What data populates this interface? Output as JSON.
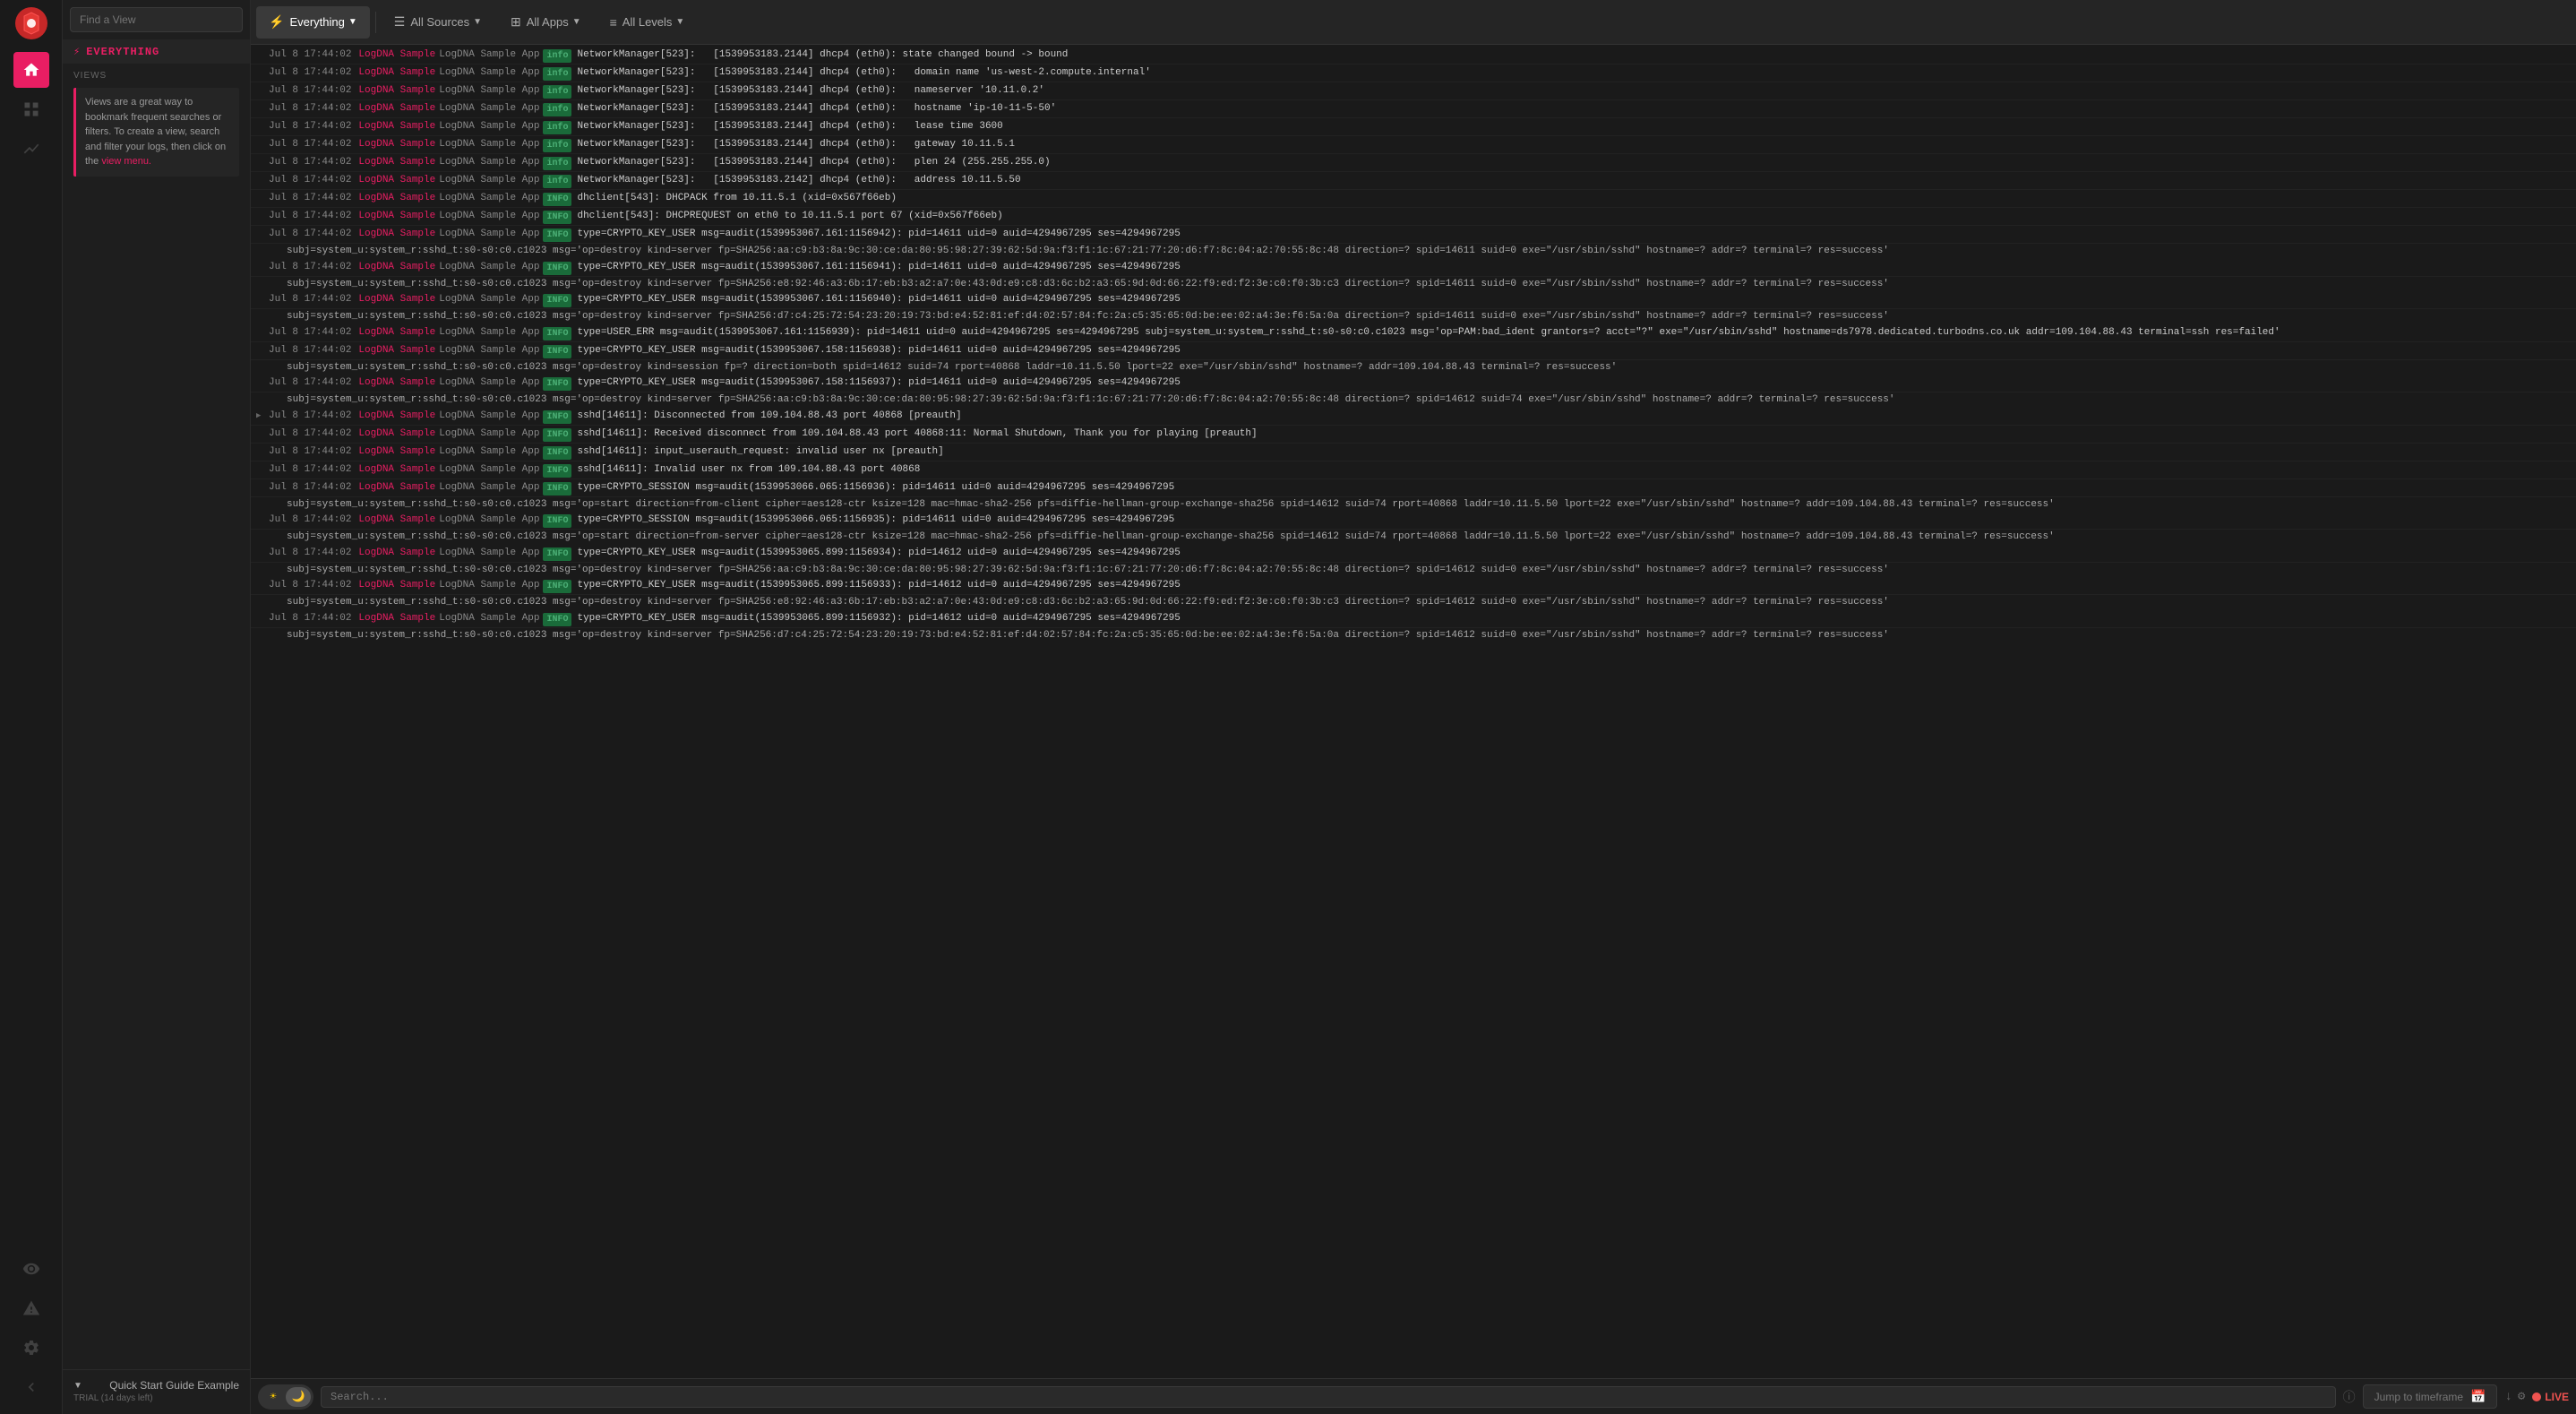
{
  "sidebar": {
    "logo_label": "LogDNA",
    "find_view_placeholder": "Find a View",
    "everything_label": "EVERYTHING",
    "views_label": "VIEWS",
    "views_hint_text": "Views are a great way to bookmark frequent searches or filters. To create a view, search and filter your logs, then click on the ",
    "views_hint_link": "view menu.",
    "quick_start_title": "Quick Start Guide Example",
    "trial_text": "TRIAL (14 days left)"
  },
  "topbar": {
    "everything_label": "Everything",
    "all_sources_label": "All Sources",
    "all_apps_label": "All Apps",
    "all_levels_label": "All Levels"
  },
  "bottombar": {
    "search_placeholder": "Search...",
    "jump_to_timeframe": "Jump to timeframe",
    "live_label": "LIVE"
  },
  "logs": [
    {
      "timestamp": "Jul 8 17:44:02",
      "source": "LogDNA Sample",
      "app": "LogDNA Sample App",
      "level": "info",
      "message": "NetworkManager[523]: <info>  [1539953183.2144] dhcp4 (eth0): state changed bound -> bound"
    },
    {
      "timestamp": "Jul 8 17:44:02",
      "source": "LogDNA Sample",
      "app": "LogDNA Sample App",
      "level": "info",
      "message": "NetworkManager[523]: <info>  [1539953183.2144] dhcp4 (eth0):   domain name 'us-west-2.compute.internal'"
    },
    {
      "timestamp": "Jul 8 17:44:02",
      "source": "LogDNA Sample",
      "app": "LogDNA Sample App",
      "level": "info",
      "message": "NetworkManager[523]: <info>  [1539953183.2144] dhcp4 (eth0):   nameserver '10.11.0.2'"
    },
    {
      "timestamp": "Jul 8 17:44:02",
      "source": "LogDNA Sample",
      "app": "LogDNA Sample App",
      "level": "info",
      "message": "NetworkManager[523]: <info>  [1539953183.2144] dhcp4 (eth0):   hostname 'ip-10-11-5-50'"
    },
    {
      "timestamp": "Jul 8 17:44:02",
      "source": "LogDNA Sample",
      "app": "LogDNA Sample App",
      "level": "info",
      "message": "NetworkManager[523]: <info>  [1539953183.2144] dhcp4 (eth0):   lease time 3600"
    },
    {
      "timestamp": "Jul 8 17:44:02",
      "source": "LogDNA Sample",
      "app": "LogDNA Sample App",
      "level": "info",
      "message": "NetworkManager[523]: <info>  [1539953183.2144] dhcp4 (eth0):   gateway 10.11.5.1"
    },
    {
      "timestamp": "Jul 8 17:44:02",
      "source": "LogDNA Sample",
      "app": "LogDNA Sample App",
      "level": "info",
      "message": "NetworkManager[523]: <info>  [1539953183.2144] dhcp4 (eth0):   plen 24 (255.255.255.0)"
    },
    {
      "timestamp": "Jul 8 17:44:02",
      "source": "LogDNA Sample",
      "app": "LogDNA Sample App",
      "level": "info",
      "message": "NetworkManager[523]: <info>  [1539953183.2142] dhcp4 (eth0):   address 10.11.5.50"
    },
    {
      "timestamp": "Jul 8 17:44:02",
      "source": "LogDNA Sample",
      "app": "LogDNA Sample App",
      "level": "INFO",
      "message": "dhclient[543]: DHCPACK from 10.11.5.1 (xid=0x567f66eb)"
    },
    {
      "timestamp": "Jul 8 17:44:02",
      "source": "LogDNA Sample",
      "app": "LogDNA Sample App",
      "level": "INFO",
      "message": "dhclient[543]: DHCPREQUEST on eth0 to 10.11.5.1 port 67 (xid=0x567f66eb)"
    },
    {
      "timestamp": "Jul 8 17:44:02",
      "source": "LogDNA Sample",
      "app": "LogDNA Sample App",
      "level": "INFO",
      "message": "type=CRYPTO_KEY_USER msg=audit(1539953067.161:1156942): pid=14611 uid=0 auid=4294967295 ses=4294967295",
      "continuation": "subj=system_u:system_r:sshd_t:s0-s0:c0.c1023 msg='op=destroy kind=server fp=SHA256:aa:c9:b3:8a:9c:30:ce:da:80:95:98:27:39:62:5d:9a:f3:f1:1c:67:21:77:20:d6:f7:8c:04:a2:70:55:8c:48 direction=? spid=14611 suid=0  exe=\"/usr/sbin/sshd\" hostname=? addr=? terminal=? res=success'"
    },
    {
      "timestamp": "Jul 8 17:44:02",
      "source": "LogDNA Sample",
      "app": "LogDNA Sample App",
      "level": "INFO",
      "message": "type=CRYPTO_KEY_USER msg=audit(1539953067.161:1156941): pid=14611 uid=0 auid=4294967295 ses=4294967295",
      "continuation": "subj=system_u:system_r:sshd_t:s0-s0:c0.c1023 msg='op=destroy kind=server fp=SHA256:e8:92:46:a3:6b:17:eb:b3:a2:a7:0e:43:0d:e9:c8:d3:6c:b2:a3:65:9d:0d:66:22:f9:ed:f2:3e:c0:f0:3b:c3 direction=? spid=14611 suid=0  exe=\"/usr/sbin/sshd\" hostname=? addr=? terminal=? res=success'"
    },
    {
      "timestamp": "Jul 8 17:44:02",
      "source": "LogDNA Sample",
      "app": "LogDNA Sample App",
      "level": "INFO",
      "message": "type=CRYPTO_KEY_USER msg=audit(1539953067.161:1156940): pid=14611 uid=0 auid=4294967295 ses=4294967295",
      "continuation": "subj=system_u:system_r:sshd_t:s0-s0:c0.c1023 msg='op=destroy kind=server fp=SHA256:d7:c4:25:72:54:23:20:19:73:bd:e4:52:81:ef:d4:02:57:84:fc:2a:c5:35:65:0d:be:ee:02:a4:3e:f6:5a:0a direction=? spid=14611 suid=0  exe=\"/usr/sbin/sshd\" hostname=? addr=? terminal=? res=success'"
    },
    {
      "timestamp": "Jul 8 17:44:02",
      "source": "LogDNA Sample",
      "app": "LogDNA Sample App",
      "level": "INFO",
      "message": "type=USER_ERR msg=audit(1539953067.161:1156939): pid=14611 uid=0 auid=4294967295 ses=4294967295 subj=system_u:system_r:sshd_t:s0-s0:c0.c1023 msg='op=PAM:bad_ident grantors=? acct=\"?\" exe=\"/usr/sbin/sshd\" hostname=ds7978.dedicated.turbodns.co.uk addr=109.104.88.43 terminal=ssh res=failed'"
    },
    {
      "timestamp": "Jul 8 17:44:02",
      "source": "LogDNA Sample",
      "app": "LogDNA Sample App",
      "level": "INFO",
      "message": "type=CRYPTO_KEY_USER msg=audit(1539953067.158:1156938): pid=14611 uid=0 auid=4294967295 ses=4294967295",
      "continuation": "subj=system_u:system_r:sshd_t:s0-s0:c0.c1023 msg='op=destroy kind=session fp=? direction=both spid=14612 suid=74 rport=40868 laddr=10.11.5.50 lport=22   exe=\"/usr/sbin/sshd\" hostname=? addr=109.104.88.43 terminal=? res=success'"
    },
    {
      "timestamp": "Jul 8 17:44:02",
      "source": "LogDNA Sample",
      "app": "LogDNA Sample App",
      "level": "INFO",
      "message": "type=CRYPTO_KEY_USER msg=audit(1539953067.158:1156937): pid=14611 uid=0 auid=4294967295 ses=4294967295",
      "continuation": "subj=system_u:system_r:sshd_t:s0-s0:c0.c1023 msg='op=destroy kind=server fp=SHA256:aa:c9:b3:8a:9c:30:ce:da:80:95:98:27:39:62:5d:9a:f3:f1:1c:67:21:77:20:d6:f7:8c:04:a2:70:55:8c:48 direction=? spid=14612 suid=74   exe=\"/usr/sbin/sshd\" hostname=? addr=? terminal=? res=success'"
    },
    {
      "timestamp": "Jul 8 17:44:02",
      "source": "LogDNA Sample",
      "app": "LogDNA Sample App",
      "level": "INFO",
      "message": "sshd[14611]: Disconnected from 109.104.88.43 port 40868 [preauth]",
      "has_arrow": true
    },
    {
      "timestamp": "Jul 8 17:44:02",
      "source": "LogDNA Sample",
      "app": "LogDNA Sample App",
      "level": "INFO",
      "message": "sshd[14611]: Received disconnect from 109.104.88.43 port 40868:11: Normal Shutdown, Thank you for playing [preauth]"
    },
    {
      "timestamp": "Jul 8 17:44:02",
      "source": "LogDNA Sample",
      "app": "LogDNA Sample App",
      "level": "INFO",
      "message": "sshd[14611]: input_userauth_request: invalid user nx [preauth]"
    },
    {
      "timestamp": "Jul 8 17:44:02",
      "source": "LogDNA Sample",
      "app": "LogDNA Sample App",
      "level": "INFO",
      "message": "sshd[14611]: Invalid user nx from 109.104.88.43 port 40868"
    },
    {
      "timestamp": "Jul 8 17:44:02",
      "source": "LogDNA Sample",
      "app": "LogDNA Sample App",
      "level": "INFO",
      "message": "type=CRYPTO_SESSION msg=audit(1539953066.065:1156936): pid=14611 uid=0 auid=4294967295 ses=4294967295",
      "continuation": "subj=system_u:system_r:sshd_t:s0-s0:c0.c1023 msg='op=start direction=from-client cipher=aes128-ctr ksize=128 mac=hmac-sha2-256 pfs=diffie-hellman-group-exchange-sha256 spid=14612 suid=74 rport=40868 laddr=10.11.5.50 lport=22  exe=\"/usr/sbin/sshd\" hostname=? addr=109.104.88.43 terminal=? res=success'"
    },
    {
      "timestamp": "Jul 8 17:44:02",
      "source": "LogDNA Sample",
      "app": "LogDNA Sample App",
      "level": "INFO",
      "message": "type=CRYPTO_SESSION msg=audit(1539953066.065:1156935): pid=14611 uid=0 auid=4294967295 ses=4294967295",
      "continuation": "subj=system_u:system_r:sshd_t:s0-s0:c0.c1023 msg='op=start direction=from-server cipher=aes128-ctr ksize=128 mac=hmac-sha2-256 pfs=diffie-hellman-group-exchange-sha256 spid=14612 suid=74 rport=40868 laddr=10.11.5.50 lport=22  exe=\"/usr/sbin/sshd\" hostname=? addr=109.104.88.43 terminal=? res=success'"
    },
    {
      "timestamp": "Jul 8 17:44:02",
      "source": "LogDNA Sample",
      "app": "LogDNA Sample App",
      "level": "INFO",
      "message": "type=CRYPTO_KEY_USER msg=audit(1539953065.899:1156934): pid=14612 uid=0 auid=4294967295 ses=4294967295",
      "continuation": "subj=system_u:system_r:sshd_t:s0-s0:c0.c1023 msg='op=destroy kind=server fp=SHA256:aa:c9:b3:8a:9c:30:ce:da:80:95:98:27:39:62:5d:9a:f3:f1:1c:67:21:77:20:d6:f7:8c:04:a2:70:55:8c:48 direction=? spid=14612 suid=0  exe=\"/usr/sbin/sshd\" hostname=? addr=? terminal=? res=success'"
    },
    {
      "timestamp": "Jul 8 17:44:02",
      "source": "LogDNA Sample",
      "app": "LogDNA Sample App",
      "level": "INFO",
      "message": "type=CRYPTO_KEY_USER msg=audit(1539953065.899:1156933): pid=14612 uid=0 auid=4294967295 ses=4294967295",
      "continuation": "subj=system_u:system_r:sshd_t:s0-s0:c0.c1023 msg='op=destroy kind=server fp=SHA256:e8:92:46:a3:6b:17:eb:b3:a2:a7:0e:43:0d:e9:c8:d3:6c:b2:a3:65:9d:0d:66:22:f9:ed:f2:3e:c0:f0:3b:c3 direction=? spid=14612 suid=0  exe=\"/usr/sbin/sshd\" hostname=? addr=? terminal=? res=success'"
    },
    {
      "timestamp": "Jul 8 17:44:02",
      "source": "LogDNA Sample",
      "app": "LogDNA Sample App",
      "level": "INFO",
      "message": "type=CRYPTO_KEY_USER msg=audit(1539953065.899:1156932): pid=14612 uid=0 auid=4294967295 ses=4294967295",
      "continuation": "subj=system_u:system_r:sshd_t:s0-s0:c0.c1023 msg='op=destroy kind=server fp=SHA256:d7:c4:25:72:54:23:20:19:73:bd:e4:52:81:ef:d4:02:57:84:fc:2a:c5:35:65:0d:be:ee:02:a4:3e:f6:5a:0a direction=? spid=14612 suid=0  exe=\"/usr/sbin/sshd\" hostname=? addr=? terminal=? res=success'"
    }
  ]
}
